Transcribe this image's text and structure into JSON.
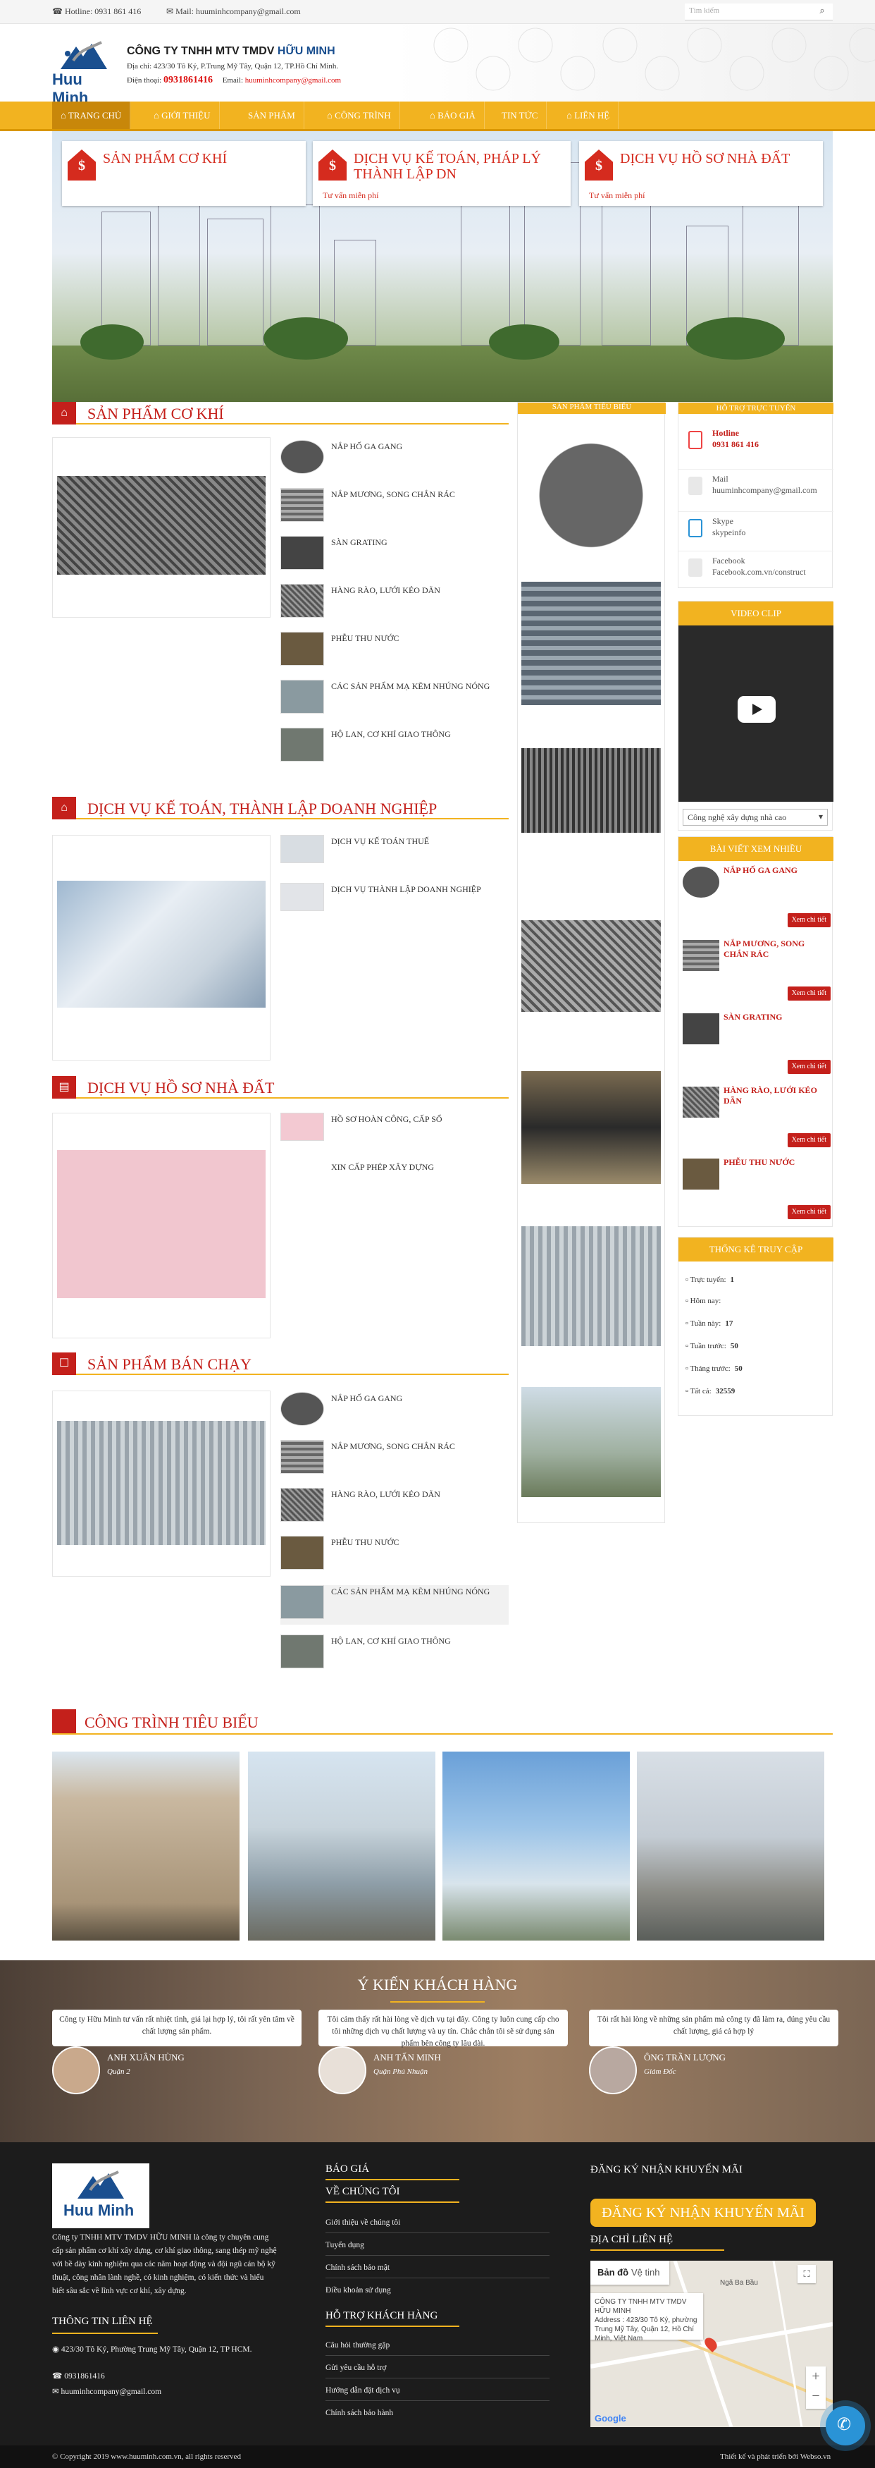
{
  "topbar": {
    "hotline": "Hotline: 0931 861 416",
    "mail": "Mail: huuminhcompany@gmail.com",
    "search_placeholder": "Tìm kiếm"
  },
  "header": {
    "logo_text": "Huu Minh",
    "company_prefix": "CÔNG TY TNHH MTV TMDV ",
    "company_name": "HỮU MINH",
    "address": "Địa chỉ: 423/30 Tô Ký, P.Trung Mỹ Tây, Quận 12, TP.Hồ Chí Minh.",
    "phone_label": "Điện thoại:",
    "phone": "0931861416",
    "email_label": "Email:",
    "email": "huuminhcompany@gmail.com"
  },
  "nav": [
    "TRANG CHỦ",
    "GIỚI THIỆU",
    "SẢN PHẨM",
    "CÔNG TRÌNH",
    "BÁO GIÁ",
    "TIN TỨC",
    "LIÊN HỆ"
  ],
  "banner": [
    {
      "title": "SẢN PHẨM CƠ KHÍ",
      "sub": ""
    },
    {
      "title": "DỊCH VỤ KẾ TOÁN, PHÁP LÝ THÀNH LẬP DN",
      "sub": "Tư vấn miễn phí"
    },
    {
      "title": "DỊCH VỤ HỒ SƠ NHÀ ĐẤT",
      "sub": "Tư vấn miễn phí"
    }
  ],
  "sections": {
    "co_khi": {
      "title": "SẢN PHẨM CƠ KHÍ",
      "items": [
        "NẮP HỐ GA GANG",
        "NẮP MƯƠNG, SONG CHẮN RÁC",
        "SÀN GRATING",
        "HÀNG RÀO, LƯỚI KÉO DÃN",
        "PHỄU THU NƯỚC",
        "CÁC SẢN PHẨM MẠ KẼM NHÚNG NÓNG",
        "HỘ LAN, CƠ KHÍ GIAO THÔNG"
      ]
    },
    "ke_toan": {
      "title": "DỊCH VỤ KẾ TOÁN, THÀNH LẬP DOANH NGHIỆP",
      "items": [
        "DỊCH VỤ KẾ TOÁN THUẾ",
        "DỊCH VỤ THÀNH LẬP DOANH NGHIỆP"
      ]
    },
    "nha_dat": {
      "title": "DỊCH VỤ HỒ SƠ NHÀ ĐẤT",
      "items": [
        "HỒ SƠ HOÀN CÔNG, CẤP SỔ",
        "XIN CẤP PHÉP XÂY DỰNG"
      ]
    },
    "ban_chay": {
      "title": "SẢN PHẨM BÁN CHẠY",
      "items": [
        "NẮP HỐ GA GANG",
        "NẮP MƯƠNG, SONG CHẮN RÁC",
        "HÀNG RÀO, LƯỚI KÉO DÃN",
        "PHỄU THU NƯỚC",
        "CÁC SẢN PHẨM MẠ KẼM NHÚNG NÓNG",
        "HỘ LAN, CƠ KHÍ GIAO THÔNG"
      ]
    }
  },
  "mid_column": {
    "title": "SẢN PHẨM TIÊU BIỂU"
  },
  "support": {
    "title": "HỖ TRỢ TRỰC TUYẾN",
    "hotline_label": "Hotline",
    "hotline": "0931 861 416",
    "mail_label": "Mail",
    "mail": "huuminhcompany@gmail.com",
    "skype_label": "Skype",
    "skype": "skypeinfo",
    "fb_label": "Facebook",
    "fb": "Facebook.com.vn/construct"
  },
  "video": {
    "title": "VIDEO CLIP",
    "select": "Công nghệ xây dựng nhà cao"
  },
  "popular": {
    "title": "BÀI VIẾT XEM NHIỀU",
    "button": "Xem chi tiết",
    "items": [
      "NẮP HỐ GA GANG",
      "NẮP MƯƠNG, SONG CHẮN RÁC",
      "SÀN GRATING",
      "HÀNG RÀO, LƯỚI KÉO DÃN",
      "PHỄU THU NƯỚC"
    ]
  },
  "stats": {
    "title": "THỐNG KÊ TRUY CẬP",
    "rows": [
      {
        "label": "Trực tuyến:",
        "value": "1"
      },
      {
        "label": "Hôm nay:",
        "value": ""
      },
      {
        "label": "Tuần này:",
        "value": "17"
      },
      {
        "label": "Tuần trước:",
        "value": "50"
      },
      {
        "label": "Tháng trước:",
        "value": "50"
      },
      {
        "label": "Tất cả:",
        "value": "32559"
      }
    ]
  },
  "projects": {
    "title": "CÔNG TRÌNH TIÊU BIỂU"
  },
  "testimonials": {
    "title": "Ý KIẾN KHÁCH HÀNG",
    "items": [
      {
        "quote": "Công ty Hữu Minh tư vấn rất nhiệt tình, giá lại hợp lý, tôi rất yên tâm về chất lượng sản phẩm.",
        "name": "ANH XUÂN HÙNG",
        "role": "Quận 2"
      },
      {
        "quote": "Tôi cảm thấy rất hài lòng về dịch vụ tại đây. Công ty luôn cung cấp cho tôi những dịch vụ chất lượng và uy tín. Chắc chắn tôi sẽ sử dụng sản phẩm bên công ty lâu dài.",
        "name": "ANH TẤN MINH",
        "role": "Quận Phú Nhuận"
      },
      {
        "quote": "Tôi rất hài lòng về những sản phẩm mà công ty đã làm ra, đúng yêu cầu chất lượng, giá cả hợp lý",
        "name": "ÔNG TRẦN LƯỢNG",
        "role": "Giám Đốc"
      }
    ]
  },
  "footer": {
    "desc": "Công ty TNHH MTV TMDV HỮU MINH là công ty chuyên cung cấp sản phẩm cơ khí xây dựng, cơ khí giao thông, sang thép mỹ nghệ với bề dày kinh nghiệm qua các năm hoạt động và đội ngũ cán bộ kỹ thuật, công nhân lành nghề, có kinh nghiệm, có kiến thức và hiểu biết sâu sắc về lĩnh vực cơ khí, xây dựng.",
    "contact_title": "THÔNG TIN LIÊN HỆ",
    "contact_addr": "423/30 Tô Ký, Phường Trung Mỹ Tây, Quận 12, TP HCM.",
    "contact_phone": "0931861416",
    "contact_mail": "huuminhcompany@gmail.com",
    "bao_gia": "BÁO GIÁ",
    "about_title": "VỀ CHÚNG TÔI",
    "about": [
      "Giới thiệu về chúng tôi",
      "Tuyển dụng",
      "Chính sách bảo mật",
      "Điều khoản sử dụng"
    ],
    "help_title": "HỖ TRỢ KHÁCH HÀNG",
    "help": [
      "Câu hỏi thường gặp",
      "Gửi yêu cầu hỗ trợ",
      "Hướng dẫn đặt dịch vụ",
      "Chính sách bảo hành"
    ],
    "subscribe_title": "ĐĂNG KÝ NHẬN KHUYẾN MÃI",
    "subscribe_btn": "ĐĂNG KÝ NHẬN KHUYẾN MÃI",
    "address_title": "ĐỊA CHỈ LIÊN HỆ",
    "map_tab1": "Bản đồ",
    "map_tab2": "Vệ tinh",
    "map_info": "CÔNG TY TNHH MTV TMDV HỮU MINH",
    "map_info_addr": "Address : 423/30 Tô Ký, phường Trung Mỹ Tây, Quận 12, Hồ Chí Minh, Việt Nam",
    "map_place": "Ngã Ba Bầu",
    "map_brand": "Google"
  },
  "copyright": {
    "left": "© Copyright 2019 www.huuminh.com.vn, all rights reserved",
    "right": "Thiết kế và phát triển bởi Webso.vn"
  },
  "colors": {
    "accent": "#f2b320",
    "brand_red": "#c4201b",
    "logo_blue": "#1a4f8f"
  }
}
